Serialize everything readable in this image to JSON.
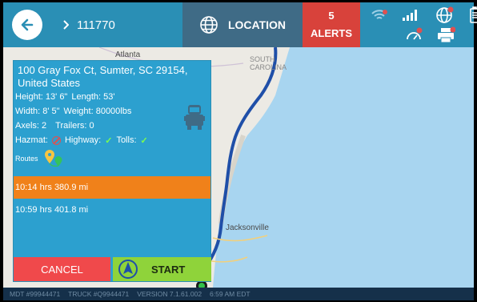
{
  "header": {
    "route_id": "111770",
    "location_label": "LOCATION",
    "alerts_count": "5",
    "alerts_label": "ALERTS"
  },
  "map": {
    "labels": {
      "atlanta": "Atlanta",
      "south_carolina": "SOUTH CAROLINA",
      "jacksonville": "Jacksonville"
    }
  },
  "panel": {
    "address": "100 Gray Fox Ct, Sumter, SC 29154, United States",
    "height_label": "Height:",
    "height_value": "13' 6\"",
    "length_label": "Length:",
    "length_value": "53'",
    "width_label": "Width:",
    "width_value": "8' 5\"",
    "weight_label": "Weight:",
    "weight_value": "80000lbs",
    "axels_label": "Axels:",
    "axels_value": "2",
    "trailers_label": "Trailers:",
    "trailers_value": "0",
    "hazmat_label": "Hazmat:",
    "highway_label": "Highway:",
    "tolls_label": "Tolls:",
    "routes_label": "Routes",
    "options": [
      {
        "time": "10:14 hrs",
        "distance": "380.9 mi"
      },
      {
        "time": "10:59 hrs",
        "distance": "401.8 mi"
      }
    ],
    "cancel_label": "CANCEL",
    "start_label": "START"
  },
  "footer": {
    "mdt": "MDT #99944471",
    "truck": "TRUCK #Q9944471",
    "version": "VERSION  7.1.61.002",
    "time": "6:59 AM EDT"
  },
  "colors": {
    "header_bg": "#2a8fb5",
    "location_bg": "#3f6b86",
    "alerts_bg": "#d8423b",
    "panel_bg": "#2ca0cf",
    "selected_route": "#f0811a",
    "cancel": "#f0494b",
    "start": "#8fd33a",
    "route_line": "#1f4fa8"
  },
  "icons": [
    "back-arrow-icon",
    "chevron-right-icon",
    "globe-icon",
    "wifi-icon",
    "signal-icon",
    "speedometer-icon",
    "printer-icon",
    "battery-icon",
    "truck-icon",
    "route-pins-icon",
    "navigation-arrow-icon",
    "blocked-icon",
    "check-icon"
  ]
}
